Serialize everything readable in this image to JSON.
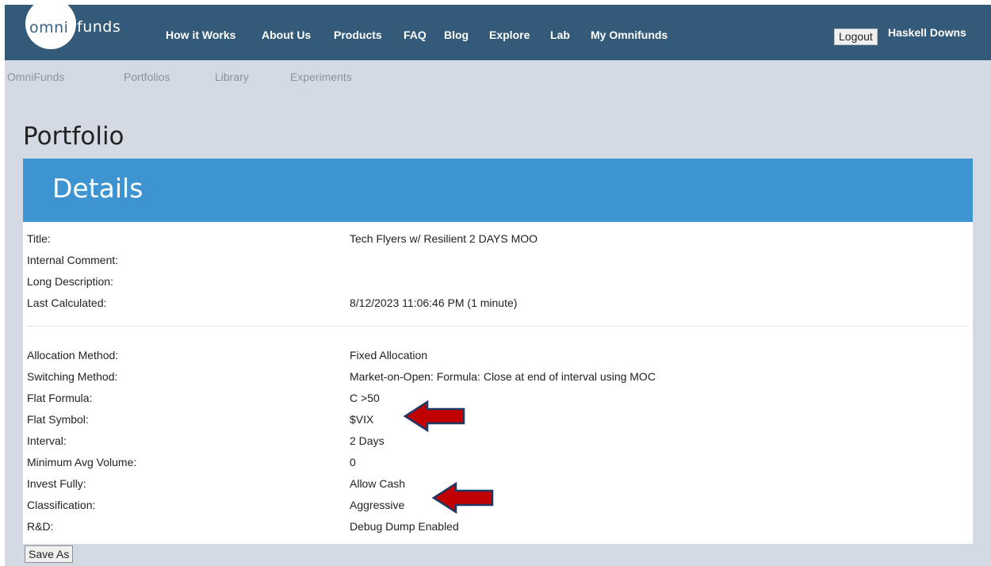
{
  "logo": {
    "part1": "omni",
    "part2": "funds"
  },
  "nav": {
    "items": [
      "How it Works",
      "About Us",
      "Products",
      "FAQ",
      "Blog",
      "Explore",
      "Lab",
      "My Omnifunds"
    ],
    "logout_label": "Logout",
    "user_name": "Haskell Downs"
  },
  "subnav": {
    "items": [
      "OmniFunds",
      "Portfolios",
      "Library",
      "Experiments"
    ]
  },
  "page": {
    "title": "Portfolio"
  },
  "details": {
    "header": "Details",
    "group1": [
      {
        "label": "Title:",
        "value": "Tech Flyers w/ Resilient 2 DAYS MOO"
      },
      {
        "label": "Internal Comment:",
        "value": ""
      },
      {
        "label": "Long Description:",
        "value": ""
      },
      {
        "label": "Last Calculated:",
        "value": "8/12/2023 11:06:46 PM (1 minute)"
      }
    ],
    "group2": [
      {
        "label": "Allocation Method:",
        "value": "Fixed Allocation"
      },
      {
        "label": "Switching Method:",
        "value": "Market-on-Open: Formula: Close at end of interval using MOC"
      },
      {
        "label": "Flat Formula:",
        "value": "C >50"
      },
      {
        "label": "Flat Symbol:",
        "value": "$VIX"
      },
      {
        "label": "Interval:",
        "value": "2 Days"
      },
      {
        "label": "Minimum Avg Volume:",
        "value": "0"
      },
      {
        "label": "Invest Fully:",
        "value": "Allow Cash"
      },
      {
        "label": "Classification:",
        "value": "Aggressive"
      },
      {
        "label": "R&D:",
        "value": "Debug Dump Enabled"
      }
    ]
  },
  "actions": {
    "save_as_label": "Save As"
  },
  "colors": {
    "navbar": "#345a7a",
    "page_bg": "#d3dae3",
    "details_header": "#3e94d1",
    "annotation_arrow": "#c00000"
  },
  "annotations": [
    "arrow-annotation-icon",
    "arrow-annotation-icon"
  ]
}
